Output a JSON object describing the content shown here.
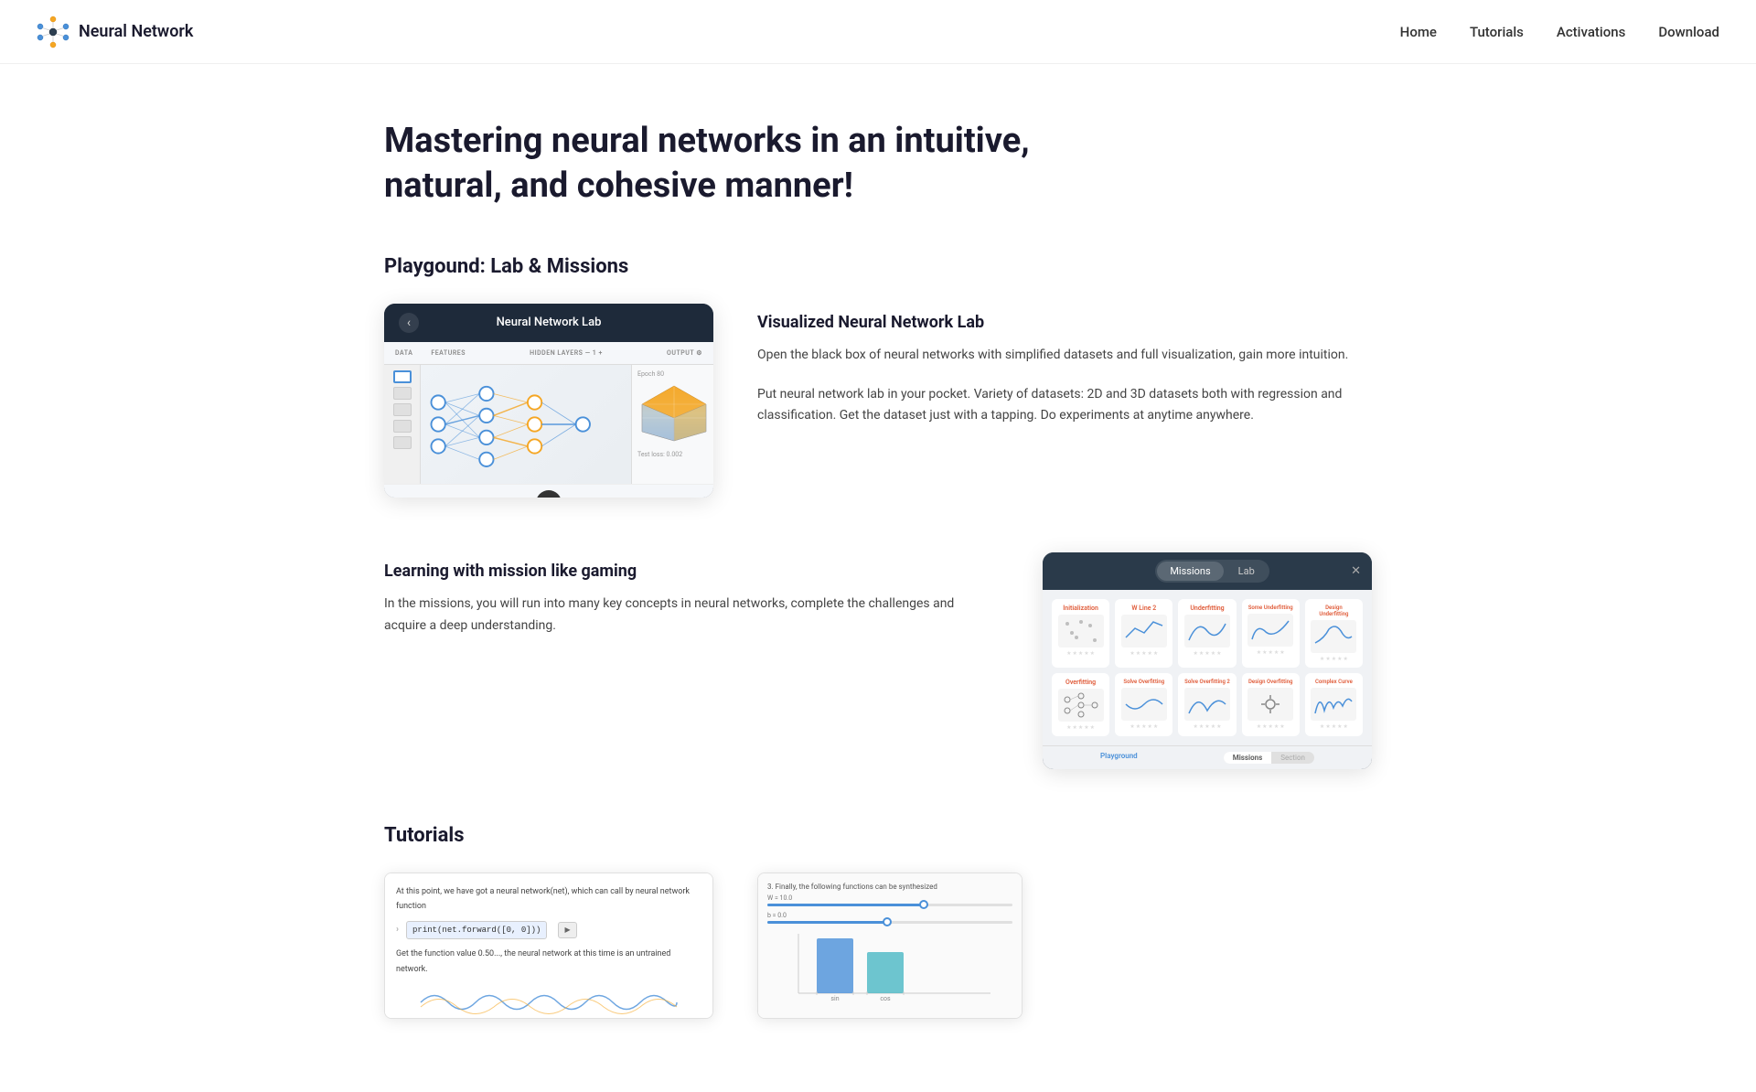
{
  "brand": {
    "name": "Neural Network",
    "icon_alt": "neural-network-logo"
  },
  "nav": {
    "links": [
      {
        "label": "Home",
        "id": "home"
      },
      {
        "label": "Tutorials",
        "id": "tutorials"
      },
      {
        "label": "Activations",
        "id": "activations"
      },
      {
        "label": "Download",
        "id": "download"
      }
    ]
  },
  "hero": {
    "title": "Mastering neural networks in an intuitive, natural, and cohesive manner!"
  },
  "playground": {
    "section_title": "Playgound: Lab & Missions",
    "lab": {
      "feature_title": "Visualized Neural Network Lab",
      "description_1": "Open the black box of neural networks with simplified datasets and full visualization, gain more intuition.",
      "description_2": "Put neural network lab in your pocket. Variety of datasets: 2D and 3D datasets both with regression and classification. Get the dataset just with a tapping. Do experiments at anytime anywhere.",
      "screenshot_title": "Neural Network Lab"
    },
    "missions": {
      "feature_title": "Learning with mission like gaming",
      "description": "In the missions, you will run into many key concepts in neural networks, complete the challenges and acquire a deep understanding.",
      "tab_missions": "Missions",
      "tab_lab": "Lab",
      "cards": [
        {
          "title": "Initialization",
          "color": "orange"
        },
        {
          "title": "W Line 2",
          "color": "orange"
        },
        {
          "title": "Underfitting",
          "color": "orange"
        },
        {
          "title": "Some Underfitting",
          "color": "orange"
        },
        {
          "title": "Design Underfitting",
          "color": "orange"
        },
        {
          "title": "Overfitting",
          "color": "orange"
        },
        {
          "title": "Solve Overfitting",
          "color": "orange"
        },
        {
          "title": "Solve Overfitting 2",
          "color": "orange"
        },
        {
          "title": "Design Overfitting",
          "color": "orange"
        },
        {
          "title": "Complex Curve",
          "color": "orange"
        }
      ]
    }
  },
  "tutorials": {
    "section_title": "Tutorials",
    "code_text_1": "At this point, we have got a neural network(net), which can call by neural network function",
    "code_snippet": "print(net.forward([0, 0]))",
    "code_text_2": "Get the function value 0.50..., the neural network at this time is an untrained network.",
    "chart_title": "3. Finally, the following functions can be synthesized"
  }
}
